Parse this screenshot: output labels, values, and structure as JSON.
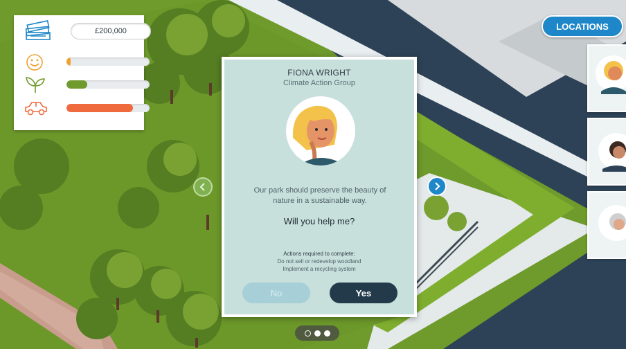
{
  "stats": {
    "money": "£200,000",
    "happiness": {
      "icon": "smiley-icon",
      "level": 0.05,
      "color": "#f0a030"
    },
    "environment": {
      "icon": "leaf-icon",
      "level": 0.25,
      "color": "#6f9a2c"
    },
    "traffic": {
      "icon": "car-icon",
      "level": 0.8,
      "color": "#ef6a3c"
    }
  },
  "locations": {
    "label": "LOCATIONS",
    "thumbnails": [
      "fiona-wright",
      "person-2",
      "person-3"
    ]
  },
  "dialog": {
    "name": "FIONA WRIGHT",
    "group": "Climate Action Group",
    "message": "Our park should preserve the beauty of nature in a sustainable way.",
    "question": "Will you help me?",
    "actions_title": "Actions required to complete:",
    "actions": [
      "Do not sell or redevelop woodland",
      "Implement a recycling system"
    ],
    "no_label": "No",
    "yes_label": "Yes"
  },
  "pagination": {
    "total": 3,
    "current": 1
  },
  "colors": {
    "accent": "#1e87c9",
    "dialog_bg": "#c8e0dc",
    "yes_button": "#223a4a",
    "no_button": "#a6cfd8"
  }
}
